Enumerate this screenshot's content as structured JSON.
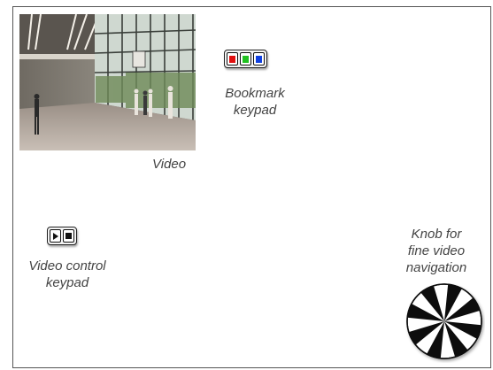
{
  "labels": {
    "video": "Video",
    "bookmark_line1": "Bookmark",
    "bookmark_line2": "keypad",
    "video_control_line1": "Video control",
    "video_control_line2": "keypad",
    "knob_line1": "Knob for",
    "knob_line2": "fine video",
    "knob_line3": "navigation"
  },
  "colors": {
    "bookmark_red": "#e01010",
    "bookmark_green": "#20c020",
    "bookmark_blue": "#1040e0"
  },
  "icons": {
    "video_control_keys": [
      "play-icon",
      "stop-icon"
    ],
    "knob": "knob-icon"
  }
}
